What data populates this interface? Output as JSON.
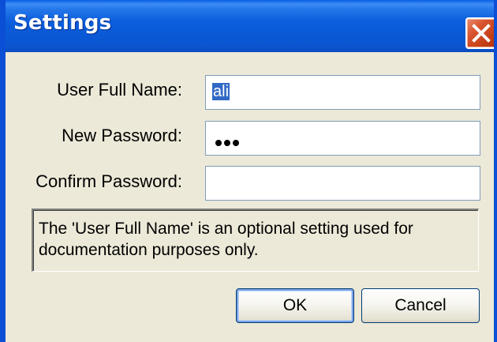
{
  "dialog": {
    "title": "Settings"
  },
  "fields": {
    "full_name": {
      "label": "User Full Name:",
      "value": "ali"
    },
    "new_password": {
      "label": "New Password:",
      "masked_length": 3
    },
    "confirm_password": {
      "label": "Confirm Password:",
      "value": ""
    }
  },
  "info": {
    "text": "The 'User Full Name' is an optional setting used for documentation purposes only."
  },
  "buttons": {
    "ok": "OK",
    "cancel": "Cancel"
  },
  "icons": {
    "close": "close-icon"
  },
  "colors": {
    "titlebar": "#0a58d6",
    "close_button": "#c43d14",
    "dialog_background": "#ece9d8",
    "selection": "#3169c6"
  }
}
